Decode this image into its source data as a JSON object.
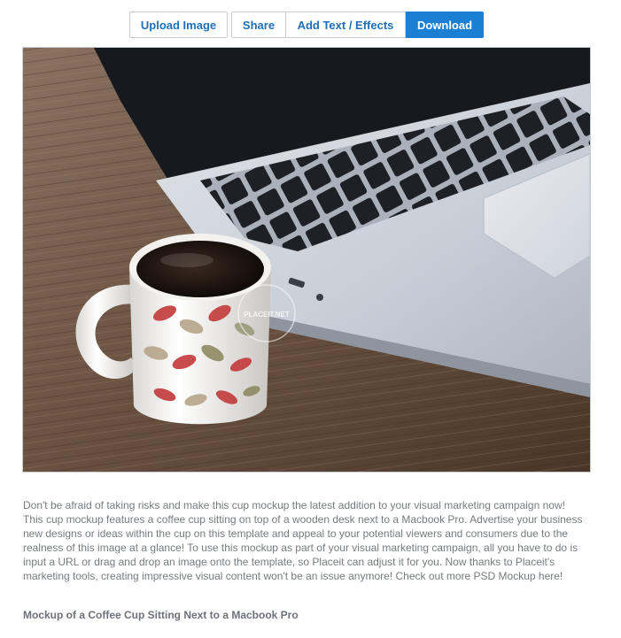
{
  "toolbar": {
    "upload_label": "Upload Image",
    "share_label": "Share",
    "effects_label": "Add Text / Effects",
    "download_label": "Download"
  },
  "mockup": {
    "watermark": "PLACEIT.NET",
    "accent_color": "#1b7fd3"
  },
  "description": "Don't be afraid of taking risks and make this cup mockup the latest addition to your visual marketing campaign now! This cup mockup features a coffee cup sitting on top of a wooden desk next to a Macbook Pro. Advertise your business new designs or ideas within the cup on this template and appeal to your potential viewers and consumers due to the realness of this image at a glance! To use this mockup as part of your visual marketing campaign, all you have to do is input a URL or drag and drop an image onto the template, so Placeit can adjust it for you. Now thanks to Placeit's marketing tools, creating impressive visual content won't be an issue anymore! Check out more PSD Mockup here!",
  "caption": "Mockup of a Coffee Cup Sitting Next to a Macbook Pro"
}
